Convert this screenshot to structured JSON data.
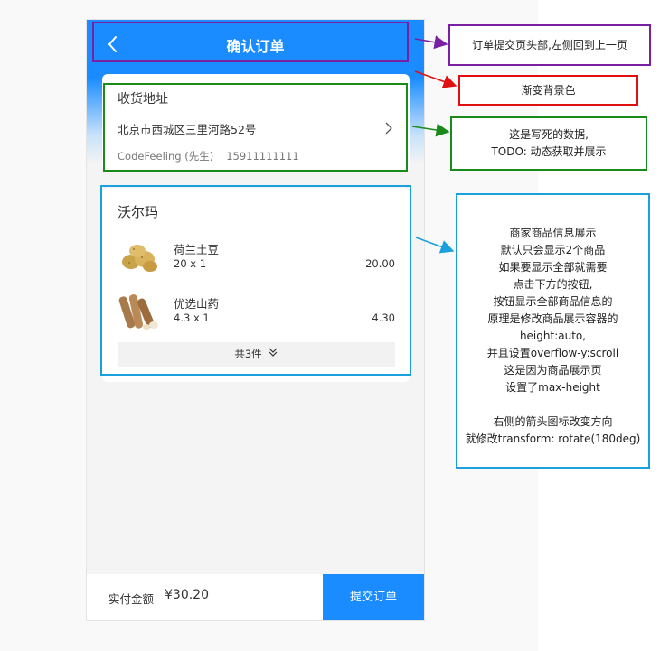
{
  "app": {
    "title": "确认订单",
    "accent_color": "#1a8cff"
  },
  "header": {
    "back_icon": "chevron-left-icon",
    "title": "确认订单"
  },
  "address": {
    "title": "收货地址",
    "text": "北京市西城区三里河路52号",
    "contact_name": "CodeFeeling (先生)",
    "contact_phone": "15911111111",
    "arrow_icon": "chevron-right-icon"
  },
  "shop": {
    "name": "沃尔玛",
    "items": [
      {
        "name": "荷兰土豆",
        "qty": "20 x 1",
        "price": "20.00",
        "image": "potato-image"
      },
      {
        "name": "优选山药",
        "qty": "4.3 x 1",
        "price": "4.30",
        "image": "yam-image"
      }
    ],
    "more_label": "共3件",
    "more_icon": "double-chevron-down-icon"
  },
  "footer": {
    "total_label": "实付金额",
    "total_value": "¥30.20",
    "submit_label": "提交订单"
  },
  "annotations": {
    "header_note": "订单提交页头部,左侧回到上一页",
    "gradient_note": "渐变背景色",
    "address_note": [
      "这是写死的数据,",
      "TODO: 动态获取并展示"
    ],
    "goods_note": [
      "商家商品信息展示",
      "默认只会显示2个商品",
      "如果要显示全部就需要",
      "点击下方的按钮,",
      "按钮显示全部商品信息的",
      "原理是修改商品展示容器的",
      "height:auto,",
      "并且设置overflow-y:scroll",
      "这是因为商品展示页",
      "设置了max-height",
      "",
      "右侧的箭头图标改变方向",
      "就修改transform: rotate(180deg)"
    ],
    "colors": {
      "purple": "#7a1fa2",
      "red": "#e01010",
      "green": "#1a8a1a",
      "blue": "#1aa0dc"
    }
  }
}
